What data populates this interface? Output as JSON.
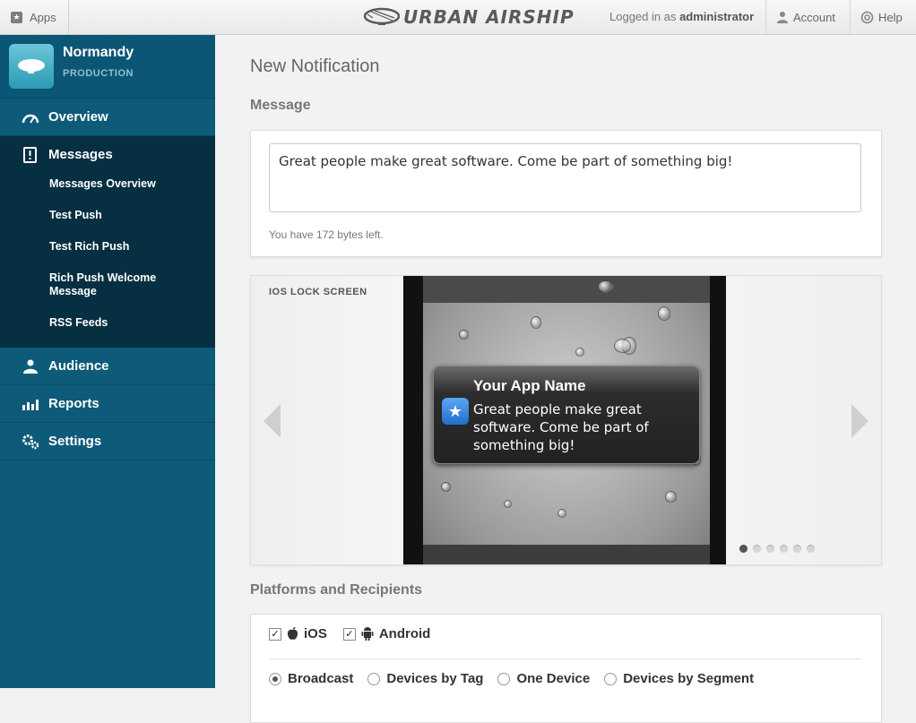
{
  "topbar": {
    "apps_label": "Apps",
    "logo_text": "URBAN AIRSHIP",
    "logged_prefix": "Logged in as",
    "username": "administrator",
    "account_label": "Account",
    "help_label": "Help"
  },
  "sidebar": {
    "account_name": "Normandy",
    "account_env": "PRODUCTION",
    "nav": {
      "overview": "Overview",
      "messages": "Messages",
      "audience": "Audience",
      "reports": "Reports",
      "settings": "Settings"
    },
    "sub_items": [
      "Messages Overview",
      "Test Push",
      "Test Rich Push",
      "Rich Push Welcome Message",
      "RSS Feeds"
    ]
  },
  "main": {
    "page_title": "New Notification",
    "message_heading": "Message",
    "message_text": "Great people make great software. Come be part of something big!",
    "bytes_left": "You have 172 bytes left.",
    "preview": {
      "label": "IOS LOCK SCREEN",
      "app_name": "Your App Name",
      "notification_text": "Great people make great software. Come be part of something big!",
      "page_count": 6,
      "active_page": 1
    },
    "platforms_heading": "Platforms and Recipients",
    "platforms": [
      {
        "label": "iOS",
        "checked": true,
        "icon": "apple-icon"
      },
      {
        "label": "Android",
        "checked": true,
        "icon": "android-icon"
      }
    ],
    "recipients": [
      {
        "label": "Broadcast",
        "selected": true
      },
      {
        "label": "Devices by Tag",
        "selected": false
      },
      {
        "label": "One Device",
        "selected": false
      },
      {
        "label": "Devices by Segment",
        "selected": false
      }
    ]
  }
}
